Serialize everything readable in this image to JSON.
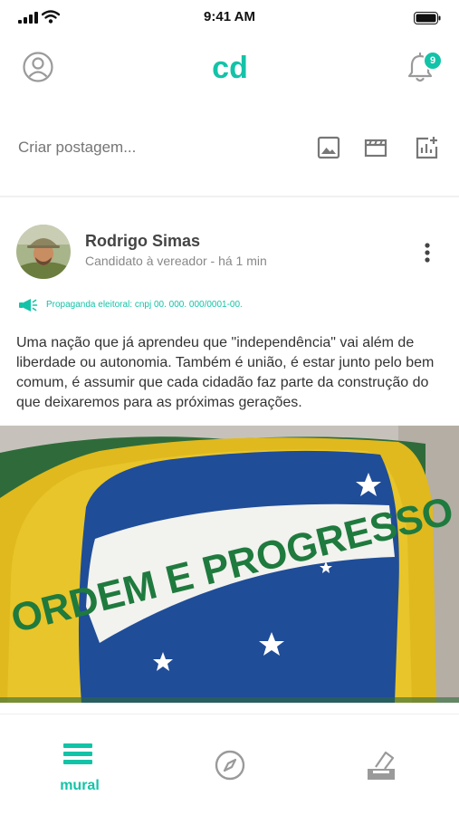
{
  "status_bar": {
    "time": "9:41 AM"
  },
  "header": {
    "logo_text": "cd",
    "notification_count": "9"
  },
  "composer": {
    "placeholder": "Criar postagem...",
    "actions": [
      "photo-icon",
      "video-icon",
      "poll-chart-icon"
    ]
  },
  "post": {
    "author": "Rodrigo Simas",
    "meta": "Candidato à vereador - há 1 min",
    "ad_notice": "Propaganda eleitoral: cnpj 00. 000. 000/0001-00.",
    "body": "Uma nação que já aprendeu que \"independência\" vai além de liberdade ou autonomia. Também é união, é estar junto pelo bem comum, é assumir que cada cidadão faz parte da construção do que deixaremos para as próximas gerações.",
    "image_text": "ORDEM E PROGRESSO"
  },
  "nav": {
    "items": [
      {
        "label": "mural",
        "icon": "mural-icon",
        "active": true
      },
      {
        "label": "",
        "icon": "compass-icon",
        "active": false
      },
      {
        "label": "",
        "icon": "ballot-box-icon",
        "active": false
      }
    ]
  },
  "colors": {
    "accent": "#13c3a8",
    "text": "#333333",
    "muted": "#888888"
  }
}
